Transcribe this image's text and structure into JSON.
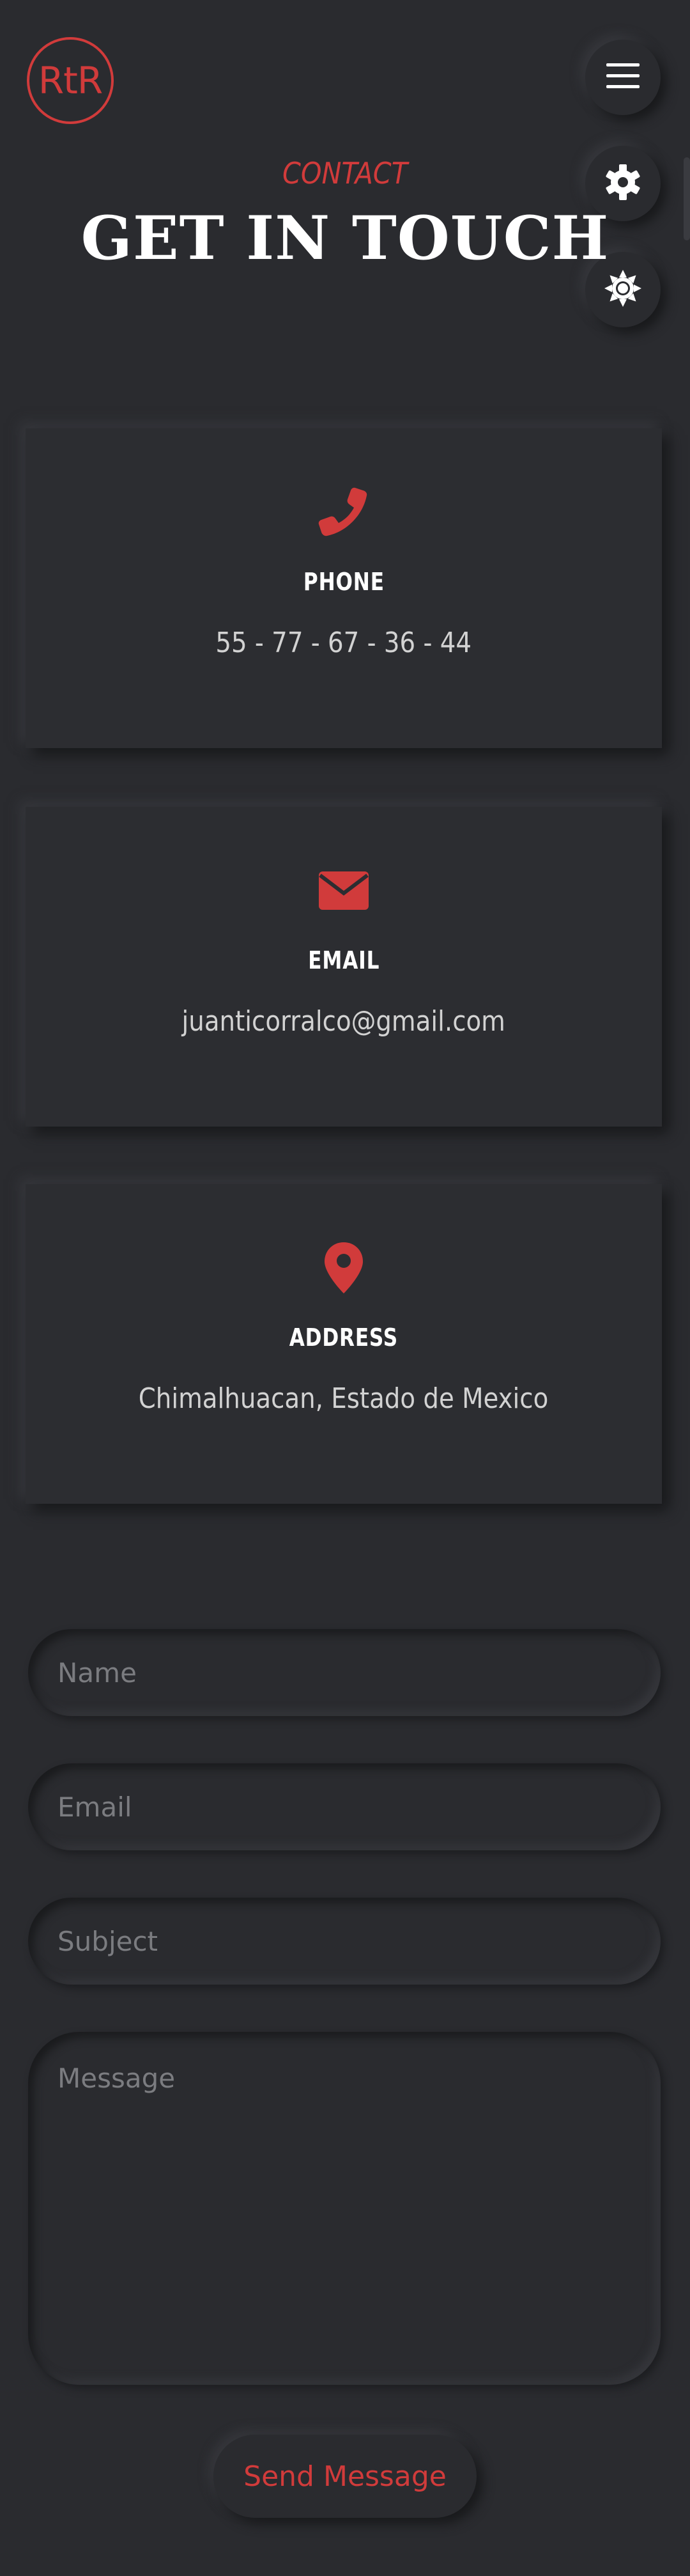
{
  "header": {
    "logo_text": "RtR",
    "buttons": {
      "menu_icon": "hamburger-menu-icon",
      "settings_icon": "gear-icon",
      "theme_icon": "sun-icon"
    }
  },
  "section": {
    "tag": "CONTACT",
    "title": "GET IN TOUCH"
  },
  "cards": {
    "phone": {
      "icon": "phone-icon",
      "title": "PHONE",
      "value": "55 - 77 - 67 - 36 - 44"
    },
    "email": {
      "icon": "envelope-icon",
      "title": "EMAIL",
      "value": "juanticorralco@gmail.com"
    },
    "address": {
      "icon": "map-pin-icon",
      "title": "ADDRESS",
      "value": "Chimalhuacan, Estado de Mexico"
    }
  },
  "form": {
    "name_placeholder": "Name",
    "email_placeholder": "Email",
    "subject_placeholder": "Subject",
    "message_placeholder": "Message",
    "send_label": "Send Message"
  },
  "colors": {
    "background": "#2a2b2f",
    "accent": "#d13b3b",
    "text": "#ffffff",
    "muted_text": "#d2d2d2",
    "placeholder": "#7b7c80"
  }
}
